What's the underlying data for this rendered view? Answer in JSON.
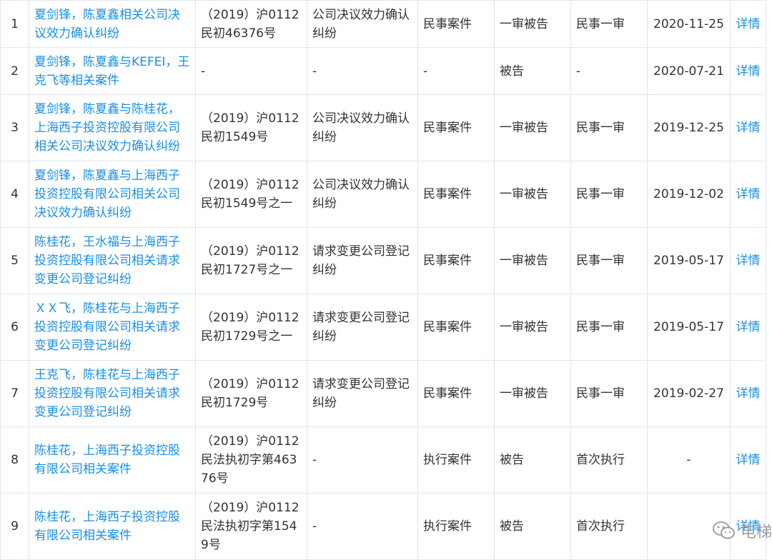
{
  "rows": [
    {
      "idx": "1",
      "name": "夏剑锋，陈夏鑫相关公司决议效力确认纠纷",
      "case_no": "（2019）沪0112民初46376号",
      "cause": "公司决议效力确认纠纷",
      "type": "民事案件",
      "role": "一审被告",
      "stage": "民事一审",
      "date": "2020-11-25",
      "link": "详情"
    },
    {
      "idx": "2",
      "name": "夏剑锋，陈夏鑫与KEFEI，王克飞等相关案件",
      "case_no": "-",
      "cause": "-",
      "type": "-",
      "role": "被告",
      "stage": "-",
      "date": "2020-07-21",
      "link": "详情"
    },
    {
      "idx": "3",
      "name": "夏剑锋，陈夏鑫与陈桂花，上海西子投资控股有限公司相关公司决议效力确认纠纷",
      "case_no": "（2019）沪0112民初1549号",
      "cause": "公司决议效力确认纠纷",
      "type": "民事案件",
      "role": "一审被告",
      "stage": "民事一审",
      "date": "2019-12-25",
      "link": "详情"
    },
    {
      "idx": "4",
      "name": "夏剑锋，陈夏鑫与上海西子投资控股有限公司相关公司决议效力确认纠纷",
      "case_no": "（2019）沪0112民初1549号之一",
      "cause": "公司决议效力确认纠纷",
      "type": "民事案件",
      "role": "一审被告",
      "stage": "民事一审",
      "date": "2019-12-02",
      "link": "详情"
    },
    {
      "idx": "5",
      "name": "陈桂花，王水福与上海西子投资控股有限公司相关请求变更公司登记纠纷",
      "case_no": "（2019）沪0112民初1727号之一",
      "cause": "请求变更公司登记纠纷",
      "type": "民事案件",
      "role": "一审被告",
      "stage": "民事一审",
      "date": "2019-05-17",
      "link": "详情"
    },
    {
      "idx": "6",
      "name": "ＸＸ飞，陈桂花与上海西子投资控股有限公司相关请求变更公司登记纠纷",
      "case_no": "（2019）沪0112民初1729号之一",
      "cause": "请求变更公司登记纠纷",
      "type": "民事案件",
      "role": "一审被告",
      "stage": "民事一审",
      "date": "2019-05-17",
      "link": "详情"
    },
    {
      "idx": "7",
      "name": "王克飞，陈桂花与上海西子投资控股有限公司相关请求变更公司登记纠纷",
      "case_no": "（2019）沪0112民初1729号",
      "cause": "请求变更公司登记纠纷",
      "type": "民事案件",
      "role": "一审被告",
      "stage": "民事一审",
      "date": "2019-02-27",
      "link": "详情"
    },
    {
      "idx": "8",
      "name": "陈桂花，上海西子投资控股有限公司相关案件",
      "case_no": "（2019）沪0112民法执初字第46376号",
      "cause": "-",
      "type": "执行案件",
      "role": "被告",
      "stage": "首次执行",
      "date": "-",
      "link": "详情"
    },
    {
      "idx": "9",
      "name": "陈桂花，上海西子投资控股有限公司相关案件",
      "case_no": "（2019）沪0112民法执初字第1549号",
      "cause": "-",
      "type": "执行案件",
      "role": "被告",
      "stage": "首次执行",
      "date": "",
      "link": "详情"
    }
  ],
  "watermark": {
    "text": "电梯",
    "icon": "wechat-icon"
  }
}
